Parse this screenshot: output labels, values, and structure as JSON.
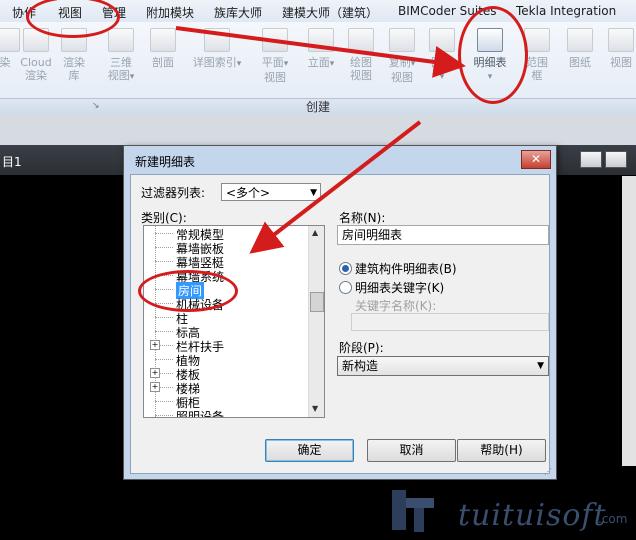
{
  "menubar": {
    "tabs": [
      "协作",
      "视图",
      "管理",
      "附加模块",
      "族库大师",
      "建模大师（建筑）",
      "BIMCoder Suites",
      "Tekla Integration"
    ]
  },
  "ribbon": {
    "buttons": [
      {
        "label1": "染",
        "label2": "",
        "icon": "render-icon"
      },
      {
        "label1": "Cloud",
        "label2": "渲染",
        "icon": "cloud-render-icon"
      },
      {
        "label1": "渲染",
        "label2": "库",
        "icon": "render-gallery-icon"
      },
      {
        "label1": "三维",
        "label2": "视图",
        "icon": "3d-view-icon"
      },
      {
        "label1": "剖面",
        "label2": "",
        "icon": "section-icon"
      },
      {
        "label1": "详图索引",
        "label2": "",
        "icon": "callout-icon"
      },
      {
        "label1": "平面",
        "label2": "视图",
        "icon": "plan-view-icon"
      },
      {
        "label1": "立面",
        "label2": "",
        "icon": "elevation-icon"
      },
      {
        "label1": "绘图",
        "label2": "视图",
        "icon": "drafting-view-icon"
      },
      {
        "label1": "复制",
        "label2": "视图",
        "icon": "duplicate-view-icon"
      },
      {
        "label1": "图例",
        "label2": "",
        "icon": "legend-icon"
      },
      {
        "label1": "明细表",
        "label2": "",
        "icon": "schedule-icon"
      },
      {
        "label1": "范围",
        "label2": "框",
        "icon": "scope-box-icon"
      },
      {
        "label1": "图纸",
        "label2": "",
        "icon": "sheet-icon"
      },
      {
        "label1": "视图",
        "label2": "",
        "icon": "view-icon"
      }
    ],
    "panel_label": "创建"
  },
  "view_tab": {
    "label": "目1"
  },
  "dialog": {
    "title": "新建明细表",
    "close_glyph": "✕",
    "filter_label": "过滤器列表:",
    "filter_value": "<多个>",
    "category_label": "类别(C):",
    "categories": [
      {
        "label": "常规模型",
        "expandable": false
      },
      {
        "label": "幕墙嵌板",
        "expandable": false
      },
      {
        "label": "幕墙竖梃",
        "expandable": false
      },
      {
        "label": "幕墙系统",
        "expandable": false
      },
      {
        "label": "房间",
        "expandable": false,
        "selected": true
      },
      {
        "label": "机械设备",
        "expandable": false
      },
      {
        "label": "柱",
        "expandable": false
      },
      {
        "label": "标高",
        "expandable": false
      },
      {
        "label": "栏杆扶手",
        "expandable": true
      },
      {
        "label": "植物",
        "expandable": false
      },
      {
        "label": "楼板",
        "expandable": true
      },
      {
        "label": "楼梯",
        "expandable": true
      },
      {
        "label": "橱柜",
        "expandable": false
      },
      {
        "label": "照明设备",
        "expandable": false
      }
    ],
    "name_label": "名称(N):",
    "name_value": "房间明细表",
    "radio_building": "建筑构件明细表(B)",
    "radio_key": "明细表关键字(K)",
    "key_name_label": "关键字名称(K):",
    "key_name_value": "",
    "phase_label": "阶段(P):",
    "phase_value": "新构造",
    "ok_label": "确定",
    "cancel_label": "取消",
    "help_label": "帮助(H)"
  },
  "watermark": {
    "text": "tuituisoft",
    "domain": ".com"
  }
}
